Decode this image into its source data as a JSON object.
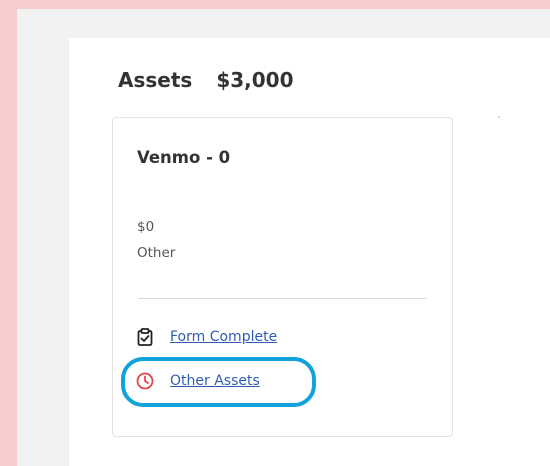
{
  "assets": {
    "label": "Assets",
    "total": "$3,000"
  },
  "card": {
    "title": "Venmo - 0",
    "amount": "$0",
    "type": "Other",
    "statuses": [
      {
        "icon": "clipboard-check-icon",
        "label": "Form Complete"
      },
      {
        "icon": "clock-icon",
        "label": "Other Assets",
        "icon_color": "#e0474c"
      }
    ]
  },
  "colors": {
    "outer_background": "#f6cccc",
    "page_background": "#f2f2f2",
    "link": "#2f5db3",
    "annotation_ring": "#12a2dc",
    "pending_icon": "#e0474c"
  }
}
